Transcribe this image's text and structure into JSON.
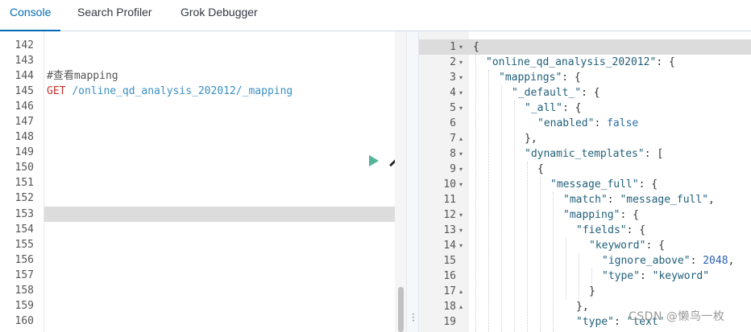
{
  "tabs": [
    {
      "label": "Console",
      "active": true
    },
    {
      "label": "Search Profiler",
      "active": false
    },
    {
      "label": "Grok Debugger",
      "active": false
    }
  ],
  "request_editor": {
    "line_numbers": [
      "142",
      "143",
      "144",
      "145",
      "146",
      "147",
      "148",
      "149",
      "150",
      "151",
      "152",
      "153",
      "154",
      "155",
      "156",
      "157",
      "158",
      "159",
      "160"
    ],
    "comment": "#查看mapping",
    "method": "GET",
    "path": "/online_qd_analysis_202012/_mapping",
    "highlighted_line": "153"
  },
  "response_viewer": {
    "line_numbers": [
      "1",
      "2",
      "3",
      "4",
      "5",
      "6",
      "7",
      "8",
      "9",
      "10",
      "11",
      "12",
      "13",
      "14",
      "15",
      "16",
      "17",
      "18",
      "19"
    ],
    "fold_markers": [
      "▾",
      "▾",
      "▾",
      "▾",
      "▾",
      "",
      "▴",
      "▾",
      "▾",
      "▾",
      "",
      "▾",
      "▾",
      "▾",
      "",
      "",
      "▴",
      "▴",
      ""
    ],
    "lines": {
      "l1": "{",
      "l2_key": "\"online_qd_analysis_202012\"",
      "l2_tail": ": {",
      "l3_key": "\"mappings\"",
      "l3_tail": ": {",
      "l4_key": "\"_default_\"",
      "l4_tail": ": {",
      "l5_key": "\"_all\"",
      "l5_tail": ": {",
      "l6_key": "\"enabled\"",
      "l6_sep": ": ",
      "l6_val": "false",
      "l7": "},",
      "l8_key": "\"dynamic_templates\"",
      "l8_tail": ": [",
      "l9": "{",
      "l10_key": "\"message_full\"",
      "l10_tail": ": {",
      "l11_key": "\"match\"",
      "l11_sep": ": ",
      "l11_val": "\"message_full\"",
      "l11_tail": ",",
      "l12_key": "\"mapping\"",
      "l12_tail": ": {",
      "l13_key": "\"fields\"",
      "l13_tail": ": {",
      "l14_key": "\"keyword\"",
      "l14_tail": ": {",
      "l15_key": "\"ignore_above\"",
      "l15_sep": ": ",
      "l15_val": "2048",
      "l15_tail": ",",
      "l16_key": "\"type\"",
      "l16_sep": ": ",
      "l16_val": "\"keyword\"",
      "l17": "}",
      "l18": "},",
      "l19_key": "\"type\"",
      "l19_sep": ": ",
      "l19_val": "\"text\""
    }
  },
  "watermark": "CSDN @懒鸟一枚",
  "colors": {
    "accent": "#006bb4",
    "run_button": "#54b399",
    "get_method": "#c9302c",
    "url": "#3a8fc5"
  },
  "icons": {
    "run": "play-icon",
    "settings": "wrench-icon"
  }
}
